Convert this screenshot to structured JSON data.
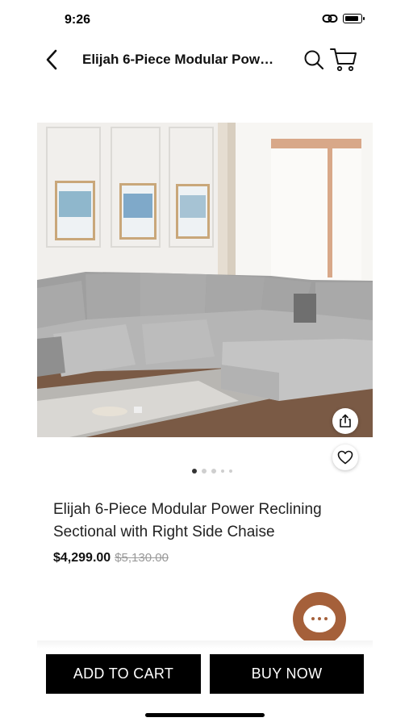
{
  "status_bar": {
    "time": "9:26"
  },
  "nav": {
    "title": "Elijah 6-Piece Modular Power Reclining Sectional with Right Side Chaise",
    "icons": [
      "back-arrow-icon",
      "search-icon",
      "cart-icon"
    ]
  },
  "gallery": {
    "image_description_icon": "sectional-sofa-image",
    "image_count": 5,
    "active_index": 0,
    "actions": [
      "share-icon",
      "heart-icon"
    ]
  },
  "product": {
    "title": "Elijah 6-Piece Modular Power Reclining Sectional with Right Side Chaise",
    "price": "$4,299.00",
    "original_price": "$5,130.00"
  },
  "chat": {
    "icon": "chat-bubble-icon",
    "color": "#a5603a"
  },
  "actions": {
    "add_to_cart": "ADD TO CART",
    "buy_now": "BUY NOW"
  }
}
